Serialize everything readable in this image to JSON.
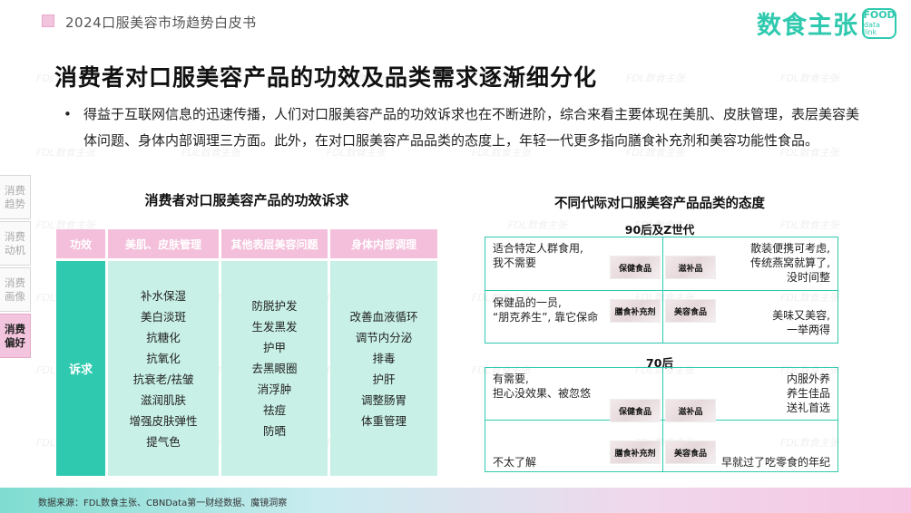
{
  "header": {
    "doc_title": "2024口服美容市场趋势白皮书",
    "brand_name": "数食主张",
    "brand_badge_top": "FOOD",
    "brand_badge_bottom": "data link"
  },
  "watermark": "FDL数食主张",
  "title": "消费者对口服美容产品的功效及品类需求逐渐细分化",
  "intro": {
    "bullet": "•",
    "text": "得益于互联网信息的迅速传播，人们对口服美容产品的功效诉求也在不断进阶，综合来看主要体现在美肌、皮肤管理，表层美容美体问题、身体内部调理三方面。此外，在对口服美容产品品类的态度上，年轻一代更多指向膳食补充剂和美容功能性食品。"
  },
  "side_nav": [
    {
      "label": "消费趋势",
      "active": false
    },
    {
      "label": "消费动机",
      "active": false
    },
    {
      "label": "消费画像",
      "active": false
    },
    {
      "label": "消费偏好",
      "active": true
    }
  ],
  "left_chart": {
    "title": "消费者对口服美容产品的功效诉求",
    "headers": [
      "功效",
      "美肌、皮肤管理",
      "其他表层美容问题",
      "身体内部调理"
    ],
    "row_label": "诉求",
    "columns": [
      [
        "补水保湿",
        "美白淡斑",
        "抗糖化",
        "抗氧化",
        "抗衰老/祛皱",
        "滋润肌肤",
        "增强皮肤弹性",
        "提气色"
      ],
      [
        "防脱护发",
        "生发黑发",
        "护甲",
        "去黑眼圈",
        "消浮肿",
        "祛痘",
        "防晒"
      ],
      [
        "改善血液循环",
        "调节内分泌",
        "排毒",
        "护肝",
        "调整肠胃",
        "体重管理"
      ]
    ]
  },
  "right_chart": {
    "title": "不同代际对口服美容产品品类的态度",
    "groups": [
      {
        "label": "90后及Z世代",
        "tl": [
          "适合特定人群食用,",
          "我不需要"
        ],
        "tr": [
          "散装便携可考虑,",
          "传统燕窝就算了,",
          "没时间整"
        ],
        "bl": [
          "保健品的一员,",
          "“朋克养生”, 靠它保命"
        ],
        "br": [
          "美味又美容,",
          "一举两得"
        ],
        "products": [
          "保健食品",
          "滋补品",
          "膳食补充剂",
          "美容食品"
        ]
      },
      {
        "label": "70后",
        "tl": [
          "有需要,",
          "担心没效果、被忽悠"
        ],
        "tr": [
          "内服外养",
          "养生佳品",
          "送礼首选"
        ],
        "bl": [
          "不太了解"
        ],
        "br": [
          "早就过了吃零食的年纪"
        ],
        "products": [
          "保健食品",
          "滋补品",
          "膳食补充剂",
          "美容食品"
        ]
      }
    ]
  },
  "footer": {
    "source": "数据来源：FDL数食主张、CBNData第一财经数据、魔镜洞察"
  }
}
